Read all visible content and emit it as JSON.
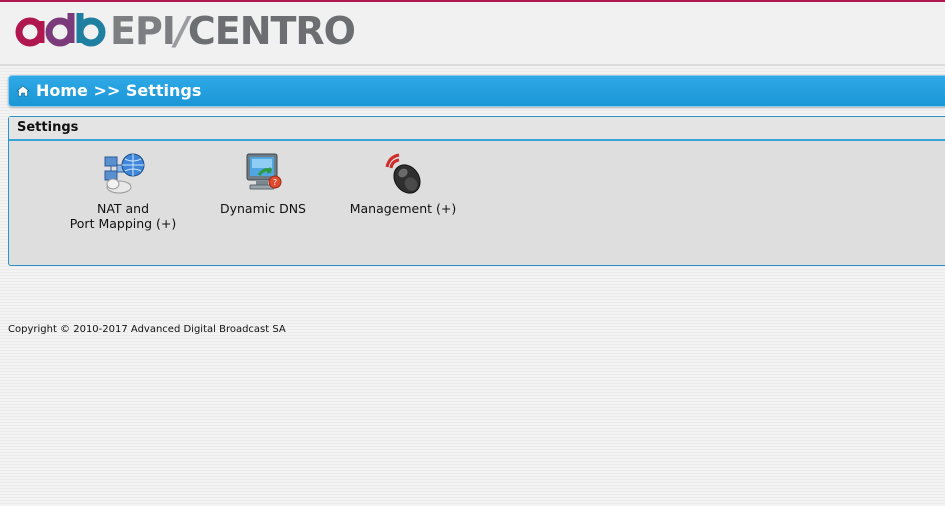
{
  "brand": {
    "mark": "adb",
    "name_part1": "EPI",
    "name_part2": "CENTRO",
    "colors": {
      "magenta": "#b0174f",
      "teal": "#1f7fa0",
      "grey": "#6d6e71"
    }
  },
  "breadcrumb": {
    "text": "Home >> Settings",
    "icon": "home-icon",
    "color": "#1b96d6"
  },
  "panel": {
    "title": "Settings",
    "items": [
      {
        "label_line1": "NAT and",
        "label_line2": "Port Mapping (+)",
        "icon": "network-globe-icon"
      },
      {
        "label_line1": "Dynamic DNS",
        "label_line2": "",
        "icon": "monitor-dns-icon"
      },
      {
        "label_line1": "Management (+)",
        "label_line2": "",
        "icon": "remote-mouse-icon"
      }
    ]
  },
  "footer": {
    "copyright": "Copyright © 2010-2017 Advanced Digital Broadcast SA"
  }
}
